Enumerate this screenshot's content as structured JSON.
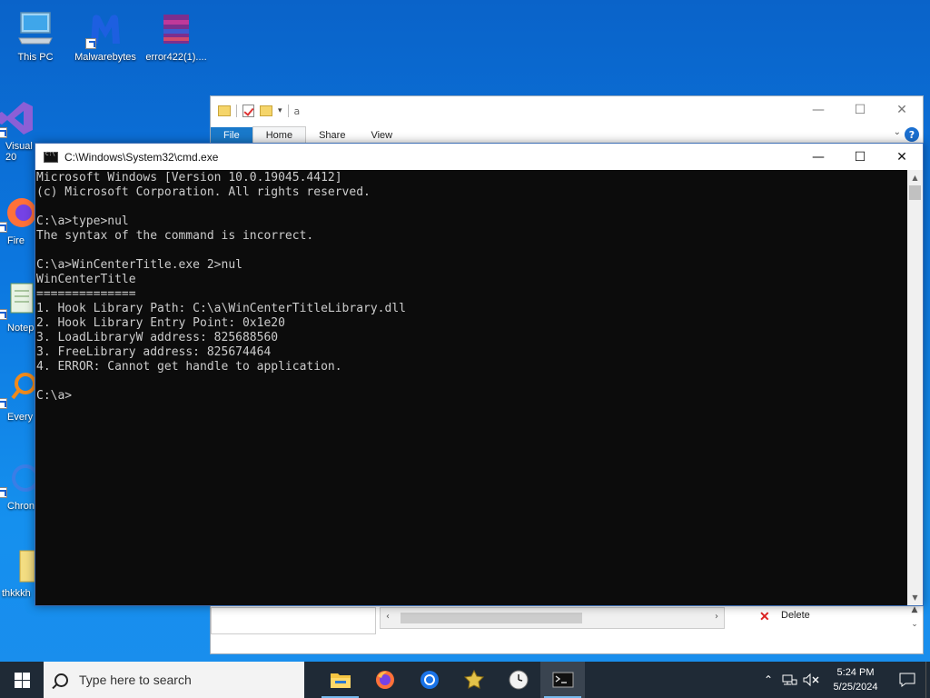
{
  "desktop": {
    "icons": [
      {
        "label": "This PC"
      },
      {
        "label": "Malwarebytes"
      },
      {
        "label": "error422(1)...."
      },
      {
        "label": "Visual\n20"
      },
      {
        "label": "Fire"
      },
      {
        "label": "Notep"
      },
      {
        "label": "Every"
      },
      {
        "label": "Chron"
      },
      {
        "label": "thkkkh"
      }
    ]
  },
  "explorer": {
    "path": "a",
    "tabs": [
      "File",
      "Home",
      "Share",
      "View"
    ],
    "help_label": "?",
    "delete_label": "Delete"
  },
  "cmd": {
    "title": "C:\\Windows\\System32\\cmd.exe",
    "lines": [
      "Microsoft Windows [Version 10.0.19045.4412]",
      "(c) Microsoft Corporation. All rights reserved.",
      "",
      "C:\\a>type>nul",
      "The syntax of the command is incorrect.",
      "",
      "C:\\a>WinCenterTitle.exe 2>nul",
      "WinCenterTitle",
      "==============",
      "1. Hook Library Path: C:\\a\\WinCenterTitleLibrary.dll",
      "2. Hook Library Entry Point: 0x1e20",
      "3. LoadLibraryW address: 825688560",
      "3. FreeLibrary address: 825674464",
      "4. ERROR: Cannot get handle to application.",
      "",
      "C:\\a>"
    ]
  },
  "taskbar": {
    "search_placeholder": "Type here to search",
    "apps": [
      "file-explorer",
      "firefox",
      "chrome",
      "winamp",
      "clock-app",
      "cmd"
    ],
    "time": "5:24 PM",
    "date": "5/25/2024"
  },
  "colors": {
    "desktop_blue": "#0c78e0",
    "taskbar": "#1f2a36",
    "console_bg": "#0c0c0c",
    "console_fg": "#cccccc",
    "ribbon_file": "#1979ca"
  }
}
